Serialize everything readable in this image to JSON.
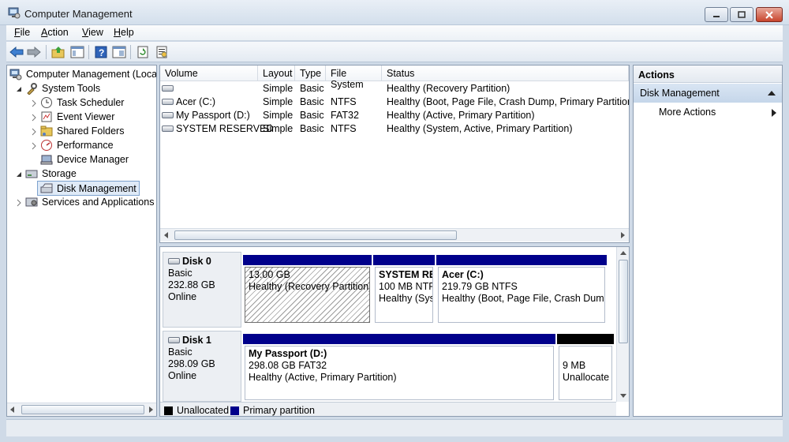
{
  "window": {
    "title": "Computer Management"
  },
  "menu": [
    {
      "label": "File",
      "key": "F",
      "rest": "ile"
    },
    {
      "label": "Action",
      "key": "A",
      "rest": "ction"
    },
    {
      "label": "View",
      "key": "V",
      "rest": "iew"
    },
    {
      "label": "Help",
      "key": "H",
      "rest": "elp"
    }
  ],
  "toolbar": {
    "icons": [
      "back-arrow-icon",
      "forward-arrow-icon",
      "up-folder-icon",
      "show-hide-tree-icon",
      "help-icon",
      "properties-icon",
      "refresh-icon",
      "export-list-icon"
    ]
  },
  "tree": {
    "root": "Computer Management (Local",
    "system_tools": "System Tools",
    "task_scheduler": "Task Scheduler",
    "event_viewer": "Event Viewer",
    "shared_folders": "Shared Folders",
    "performance": "Performance",
    "device_manager": "Device Manager",
    "storage": "Storage",
    "disk_management": "Disk Management",
    "services": "Services and Applications"
  },
  "volumes": {
    "columns": [
      "Volume",
      "Layout",
      "Type",
      "File System",
      "Status"
    ],
    "rows": [
      {
        "volume": "",
        "layout": "Simple",
        "type": "Basic",
        "fs": "",
        "status": "Healthy (Recovery Partition)"
      },
      {
        "volume": "Acer (C:)",
        "layout": "Simple",
        "type": "Basic",
        "fs": "NTFS",
        "status": "Healthy (Boot, Page File, Crash Dump, Primary Partition)"
      },
      {
        "volume": "My Passport (D:)",
        "layout": "Simple",
        "type": "Basic",
        "fs": "FAT32",
        "status": "Healthy (Active, Primary Partition)"
      },
      {
        "volume": "SYSTEM RESERVED",
        "layout": "Simple",
        "type": "Basic",
        "fs": "NTFS",
        "status": "Healthy (System, Active, Primary Partition)"
      }
    ]
  },
  "disks": {
    "disk0": {
      "name": "Disk 0",
      "type": "Basic",
      "size": "232.88 GB",
      "state": "Online",
      "p1": {
        "line1": "13.00 GB",
        "line2": "Healthy (Recovery Partition)"
      },
      "p2": {
        "name": "SYSTEM RES",
        "line1": "100 MB NTF",
        "line2": "Healthy (Sys"
      },
      "p3": {
        "name": "Acer  (C:)",
        "line1": "219.79 GB NTFS",
        "line2": "Healthy (Boot, Page File, Crash Dump,"
      }
    },
    "disk1": {
      "name": "Disk 1",
      "type": "Basic",
      "size": "298.09 GB",
      "state": "Online",
      "p1": {
        "name": "My Passport  (D:)",
        "line1": "298.08 GB FAT32",
        "line2": "Healthy (Active, Primary Partition)"
      },
      "p2": {
        "line1": "9 MB",
        "line2": "Unallocate"
      }
    }
  },
  "legend": {
    "unallocated": "Unallocated",
    "primary": "Primary partition"
  },
  "colors": {
    "primary": "#00008b",
    "unallocated": "#000000",
    "selection": "#c5d6ea"
  },
  "actions": {
    "header": "Actions",
    "section": "Disk Management",
    "more": "More Actions"
  }
}
